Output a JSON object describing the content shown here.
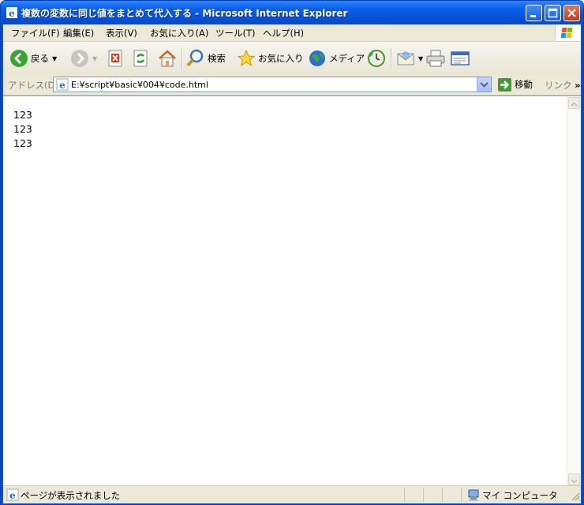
{
  "window": {
    "title": "複数の変数に同じ値をまとめて代入する - Microsoft Internet Explorer"
  },
  "menu": [
    "ファイル(F)",
    "編集(E)",
    "表示(V)",
    "お気に入り(A)",
    "ツール(T)",
    "ヘルプ(H)"
  ],
  "toolbar": {
    "back": "戻る",
    "search": "検索",
    "favorites": "お気に入り",
    "media": "メディア"
  },
  "address": {
    "label": "アドレス(D)",
    "url": "E:¥script¥basic¥004¥code.html",
    "go": "移動",
    "links": "リンク",
    "more": "»"
  },
  "content": {
    "lines": [
      "123",
      "123",
      "123"
    ]
  },
  "status": {
    "text": "ページが表示されました",
    "zone": "マイ コンピュータ"
  },
  "colors": {
    "titlebar": "#0a5ee8",
    "chrome": "#ece9d8",
    "close": "#c8361b"
  }
}
